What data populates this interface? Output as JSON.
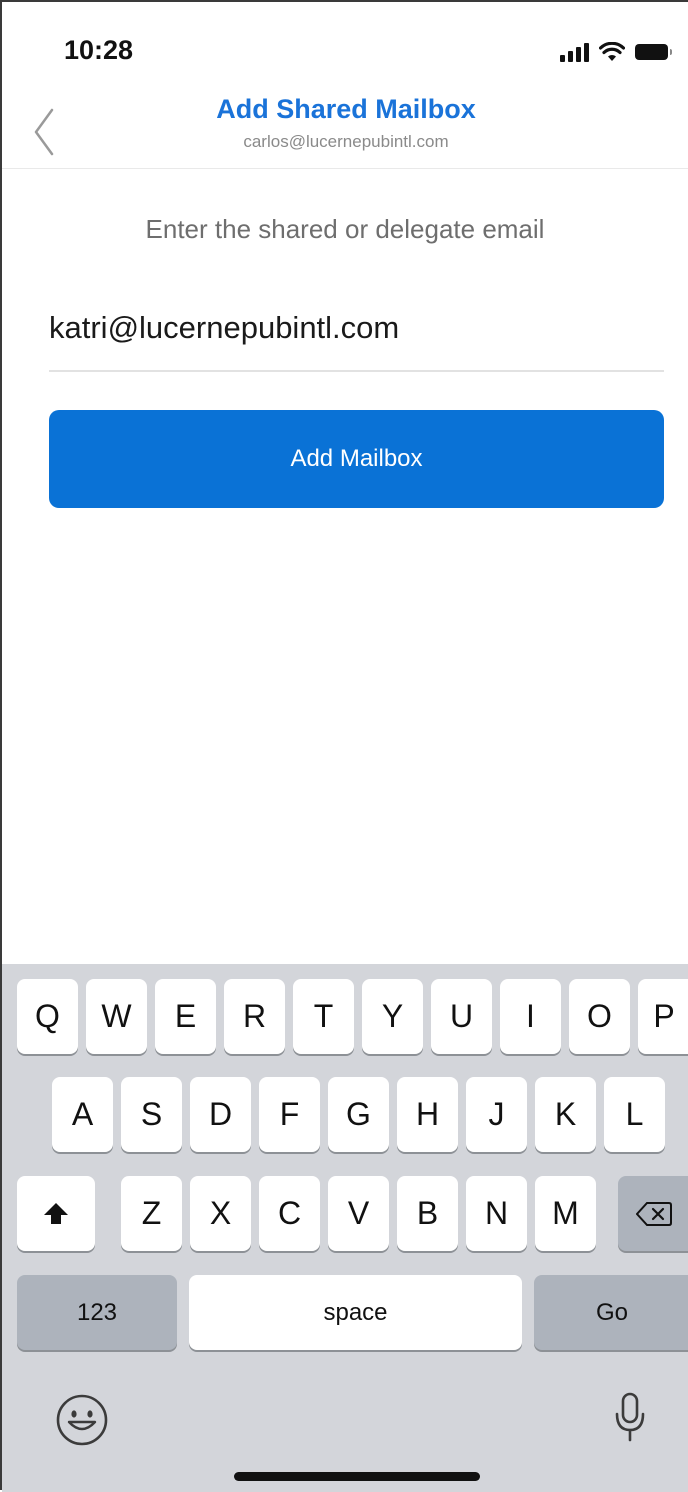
{
  "status_bar": {
    "time": "10:28"
  },
  "header": {
    "title": "Add Shared Mailbox",
    "subtitle": "carlos@lucernepubintl.com"
  },
  "form": {
    "prompt": "Enter the shared or delegate email",
    "email_value": "katri@lucernepubintl.com",
    "button_label": "Add Mailbox"
  },
  "colors": {
    "accent": "#0a72d6",
    "title": "#1a73d9",
    "keyboard_bg": "#d3d5da"
  },
  "keyboard": {
    "row1": [
      "Q",
      "W",
      "E",
      "R",
      "T",
      "Y",
      "U",
      "I",
      "O",
      "P"
    ],
    "row2": [
      "A",
      "S",
      "D",
      "F",
      "G",
      "H",
      "J",
      "K",
      "L"
    ],
    "row3": [
      "Z",
      "X",
      "C",
      "V",
      "B",
      "N",
      "M"
    ],
    "numbers_label": "123",
    "space_label": "space",
    "go_label": "Go",
    "icons": [
      "shift-icon",
      "backspace-icon",
      "emoji-icon",
      "microphone-icon"
    ]
  }
}
